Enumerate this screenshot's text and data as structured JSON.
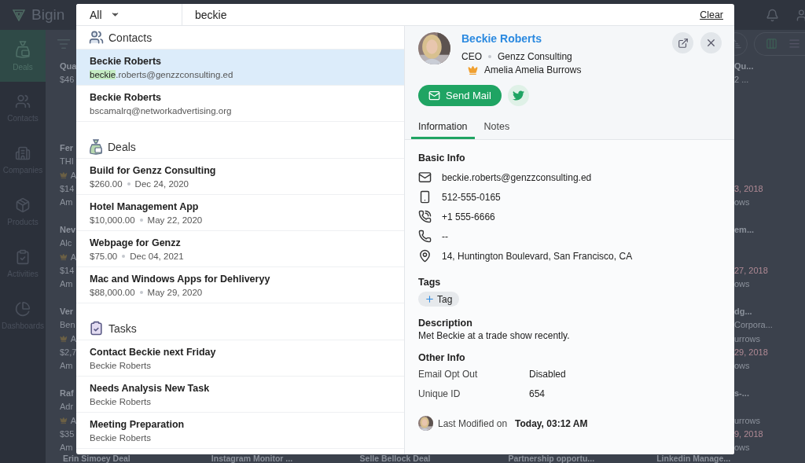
{
  "app": {
    "name": "Bigin"
  },
  "sidebar": {
    "items": [
      {
        "label": "Deals",
        "kind": "deals",
        "selected": true
      },
      {
        "label": "Contacts",
        "kind": "contacts",
        "selected": false
      },
      {
        "label": "Companies",
        "kind": "companies",
        "selected": false
      },
      {
        "label": "Products",
        "kind": "products",
        "selected": false
      },
      {
        "label": "Activities",
        "kind": "activities",
        "selected": false
      },
      {
        "label": "Dashboards",
        "kind": "dashboards",
        "selected": false
      }
    ]
  },
  "board": {
    "left_cards": [
      {
        "title": "Qua",
        "subtitle": "$46"
      },
      {
        "title": "Fer",
        "subtitle": "THI",
        "owner": "A",
        "amount": "$14",
        "contact": "Am"
      },
      {
        "title": "Nev",
        "subtitle": "Alc",
        "owner": "A",
        "amount": "$14",
        "contact": "Am"
      },
      {
        "title": "Ver",
        "subtitle": "Ben",
        "owner": "A",
        "amount": "$2,7",
        "contact": "Am"
      },
      {
        "title": "Raf",
        "subtitle": "Adr",
        "owner": "A",
        "amount": "$35",
        "contact": "Am"
      }
    ],
    "right_cards": [
      {
        "title": "Qu...",
        "subtitle": "2 ..."
      },
      {
        "date": "3, 2018",
        "contact": "ows"
      },
      {
        "title": "em...",
        "date": "27, 2018",
        "contact": "ows"
      },
      {
        "title": "dg...",
        "subtitle": "Corpora...",
        "owner_text": "urrows",
        "date": "29, 2018",
        "contact": "ows"
      },
      {
        "title": "s-...",
        "owner_text": "urrows",
        "date": "9, 2018",
        "contact": "ows"
      }
    ],
    "bottom_titles": [
      "Erin Simoey Deal",
      "Instagram Monitor ...",
      "Selle Bellock Deal",
      "Partnership opportu...",
      "Linkedin Manage..."
    ]
  },
  "search": {
    "scope": "All",
    "value": "beckie",
    "clear": "Clear"
  },
  "results": [
    {
      "heading": "Contacts",
      "kind": "contacts",
      "items": [
        {
          "title": "Beckie Roberts",
          "highlight": "beckie",
          "subtitle": ".roberts@genzzconsulting.ed",
          "selected": true
        },
        {
          "title": "Beckie Roberts",
          "subtitle": "bscamalrq@networkadvertising.org",
          "selected": false
        }
      ]
    },
    {
      "heading": "Deals",
      "kind": "deals",
      "items": [
        {
          "title": "Build for Genzz Consulting",
          "amount": "$260.00",
          "date": "Dec 24, 2020",
          "selected": false
        },
        {
          "title": "Hotel Management App",
          "amount": "$10,000.00",
          "date": "May 22, 2020",
          "selected": false
        },
        {
          "title": "Webpage for Genzz",
          "amount": "$75.00",
          "date": "Dec 04, 2021",
          "selected": false
        },
        {
          "title": "Mac and Windows Apps for Dehliveryy",
          "amount": "$88,000.00",
          "date": "May 29, 2020",
          "selected": false
        }
      ]
    },
    {
      "heading": "Tasks",
      "kind": "tasks",
      "items": [
        {
          "title": "Contact Beckie next Friday",
          "subtitle": "Beckie Roberts",
          "selected": false
        },
        {
          "title": "Needs Analysis New Task",
          "subtitle": "Beckie Roberts",
          "selected": false
        },
        {
          "title": "Meeting Preparation",
          "subtitle": "Beckie Roberts",
          "selected": false
        }
      ]
    }
  ],
  "detail": {
    "name": "Beckie Roberts",
    "title": "CEO",
    "company": "Genzz Consulting",
    "owner": "Amelia Amelia Burrows",
    "send_mail": "Send Mail",
    "tabs": [
      {
        "label": "Information",
        "selected": true
      },
      {
        "label": "Notes",
        "selected": false
      }
    ],
    "basic_info": {
      "heading": "Basic Info",
      "rows": [
        {
          "kind": "email",
          "text": "beckie.roberts@genzzconsulting.ed"
        },
        {
          "kind": "mobile",
          "text": "512-555-0165"
        },
        {
          "kind": "phone",
          "text": "+1 555-6666"
        },
        {
          "kind": "landline",
          "text": "--"
        },
        {
          "kind": "address",
          "text": "14, Huntington Boulevard, San Francisco, CA"
        }
      ]
    },
    "tags": {
      "heading": "Tags",
      "add": "Tag"
    },
    "description": {
      "heading": "Description",
      "text": "Met Beckie at a trade show recently."
    },
    "other_info": {
      "heading": "Other Info",
      "rows": [
        {
          "label": "Email Opt Out",
          "value": "Disabled"
        },
        {
          "label": "Unique ID",
          "value": "654"
        }
      ]
    },
    "modified": {
      "label": "Last Modified on",
      "value": "Today, 03:12 AM"
    }
  }
}
